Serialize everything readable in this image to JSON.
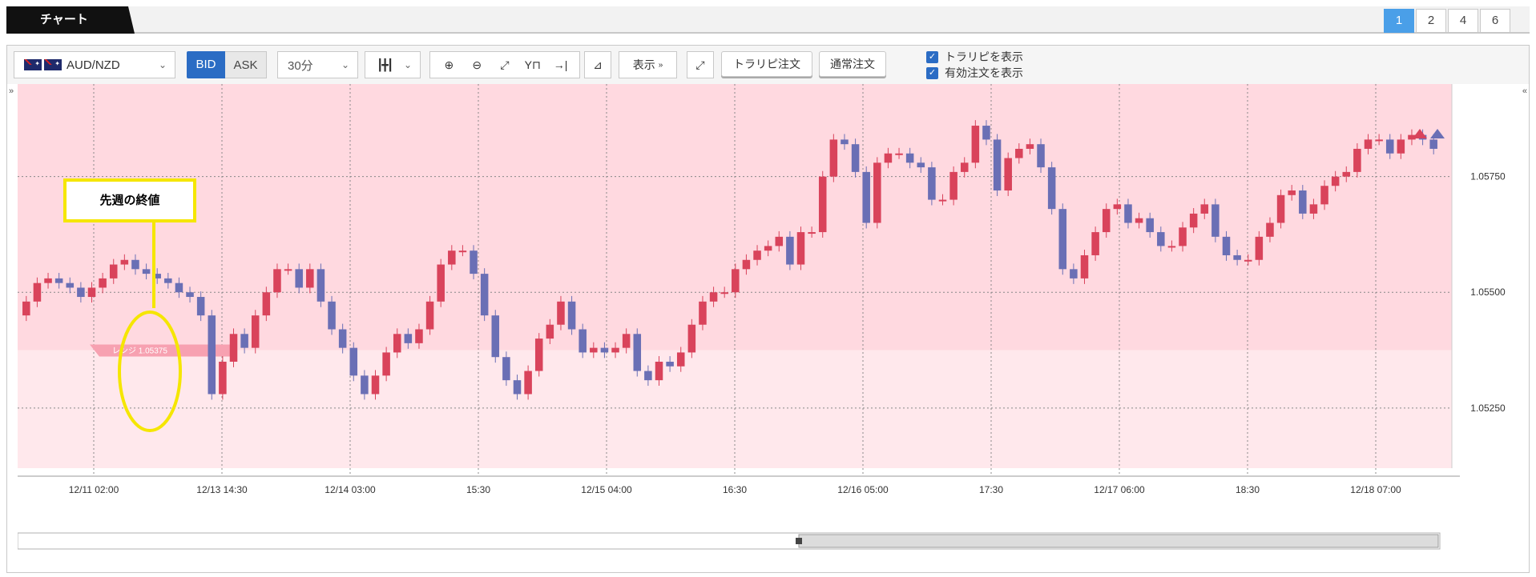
{
  "tabs": {
    "chart_label": "チャート",
    "pages": [
      "1",
      "2",
      "4",
      "6"
    ],
    "active_page": "1"
  },
  "toolbar": {
    "pair": "AUD/NZD",
    "bid": "BID",
    "ask": "ASK",
    "timeframe": "30分",
    "display": "表示",
    "traripi_order": "トラリピ注文",
    "normal_order": "通常注文",
    "show_traripi": "トラリピを表示",
    "show_active_orders": "有効注文を表示",
    "show_traripi_checked": true,
    "show_active_orders_checked": true
  },
  "colors": {
    "up": "#d9435b",
    "down": "#6a6fb5",
    "range_bg": "#ffd9e0",
    "lower_bg": "#ffe8ec",
    "accent": "#2b6cc4",
    "callout": "#f5e600"
  },
  "callout": {
    "text": "先週の終値"
  },
  "range_marker": "レンジ 1.05375",
  "chart_data": {
    "type": "candlestick",
    "y_ticks": [
      "1.05750",
      "1.05500",
      "1.05250"
    ],
    "ylim": [
      1.0512,
      1.0595
    ],
    "x_ticks": [
      "12/11 02:00",
      "12/13 14:30",
      "12/14 03:00",
      "15:30",
      "12/15 04:00",
      "16:30",
      "12/16 05:00",
      "17:30",
      "12/17 06:00",
      "18:30",
      "12/18 07:00"
    ],
    "range_line": 1.05375,
    "closes": [
      1.0548,
      1.0552,
      1.0553,
      1.0552,
      1.0551,
      1.0549,
      1.0551,
      1.0553,
      1.0556,
      1.0557,
      1.0555,
      1.0554,
      1.0553,
      1.0552,
      1.055,
      1.0549,
      1.0545,
      1.0528,
      1.0535,
      1.0541,
      1.0538,
      1.0545,
      1.055,
      1.0555,
      1.0555,
      1.0551,
      1.0555,
      1.0548,
      1.0542,
      1.0538,
      1.0532,
      1.0528,
      1.0532,
      1.0537,
      1.0541,
      1.0539,
      1.0542,
      1.0548,
      1.0556,
      1.0559,
      1.0559,
      1.0554,
      1.0545,
      1.0536,
      1.0531,
      1.0528,
      1.0533,
      1.054,
      1.0543,
      1.0548,
      1.0542,
      1.0537,
      1.0538,
      1.0537,
      1.0538,
      1.0541,
      1.0533,
      1.0531,
      1.0535,
      1.0534,
      1.0537,
      1.0543,
      1.0548,
      1.055,
      1.055,
      1.0555,
      1.0557,
      1.0559,
      1.056,
      1.0562,
      1.0556,
      1.0563,
      1.0563,
      1.0575,
      1.0583,
      1.0582,
      1.0576,
      1.0565,
      1.0578,
      1.058,
      1.058,
      1.0578,
      1.0577,
      1.057,
      1.057,
      1.0576,
      1.0578,
      1.0586,
      1.0583,
      1.0572,
      1.0579,
      1.0581,
      1.0582,
      1.0577,
      1.0568,
      1.0555,
      1.0553,
      1.0558,
      1.0563,
      1.0568,
      1.0569,
      1.0565,
      1.0566,
      1.0563,
      1.056,
      1.056,
      1.0564,
      1.0567,
      1.0569,
      1.0562,
      1.0558,
      1.0557,
      1.0557,
      1.0562,
      1.0565,
      1.0571,
      1.0572,
      1.0567,
      1.0569,
      1.0573,
      1.0575,
      1.0576,
      1.0581,
      1.0583,
      1.0583,
      1.058,
      1.0583,
      1.0584,
      1.0583,
      1.0581
    ]
  }
}
